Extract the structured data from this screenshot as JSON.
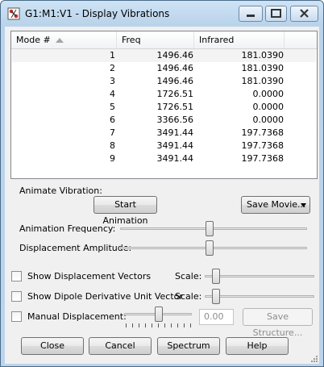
{
  "window": {
    "title": "G1:M1:V1 - Display Vibrations"
  },
  "list": {
    "columns": [
      "Mode #",
      "Freq",
      "Infrared"
    ],
    "rows": [
      {
        "mode": "1",
        "freq": "1496.46",
        "ir": "181.0390"
      },
      {
        "mode": "2",
        "freq": "1496.46",
        "ir": "181.0390"
      },
      {
        "mode": "3",
        "freq": "1496.46",
        "ir": "181.0390"
      },
      {
        "mode": "4",
        "freq": "1726.51",
        "ir": "0.0000"
      },
      {
        "mode": "5",
        "freq": "1726.51",
        "ir": "0.0000"
      },
      {
        "mode": "6",
        "freq": "3366.56",
        "ir": "0.0000"
      },
      {
        "mode": "7",
        "freq": "3491.44",
        "ir": "197.7368"
      },
      {
        "mode": "8",
        "freq": "3491.44",
        "ir": "197.7368"
      },
      {
        "mode": "9",
        "freq": "3491.44",
        "ir": "197.7368"
      }
    ]
  },
  "animate": {
    "group_label": "Animate Vibration:",
    "start_label": "Start Animation",
    "save_movie_label": "Save Movie...",
    "frequency_label": "Animation Frequency:",
    "amplitude_label": "Displacement Amplitude:",
    "frequency_level": 0.5,
    "amplitude_level": 0.5
  },
  "options": {
    "show_vectors_label": "Show Displacement Vectors",
    "show_dipole_label": "Show Dipole Derivative Unit Vector",
    "manual_label": "Manual Displacement:",
    "scale_label": "Scale:",
    "manual_value": "0.00",
    "save_structure_label": "Save Structure..."
  },
  "footer": {
    "close_label": "Close",
    "cancel_label": "Cancel",
    "spectrum_label": "Spectrum",
    "help_label": "Help"
  }
}
